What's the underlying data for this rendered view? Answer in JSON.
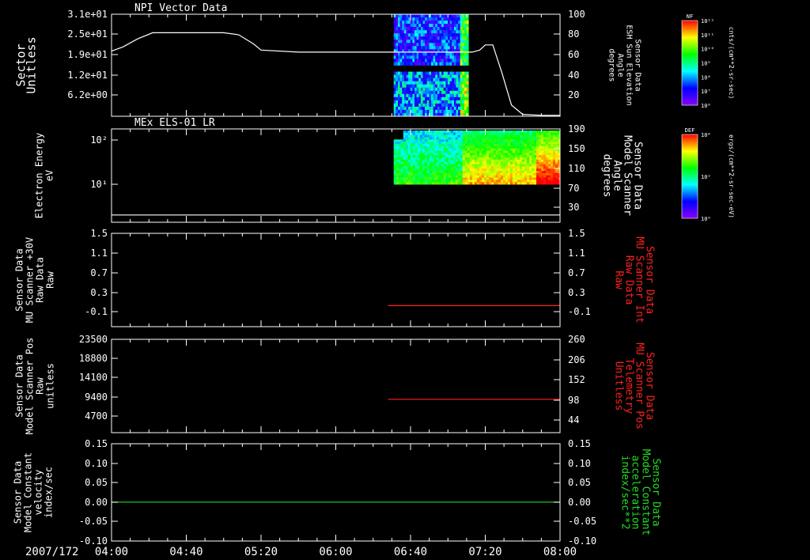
{
  "x_axis": {
    "date_label": "2007/172",
    "ticks": [
      "04:00",
      "04:40",
      "05:20",
      "06:00",
      "06:40",
      "07:20",
      "08:00"
    ],
    "range": [
      "04:00",
      "08:00"
    ]
  },
  "colors": {
    "background": "#000000",
    "axis": "#ffffff",
    "red_series": "#ff2020",
    "green_series": "#22dd22"
  },
  "chart_data": [
    {
      "type": "heatmap",
      "title": "NPI Vector Data",
      "ylabel_lines": [
        "Sector",
        "Unitless"
      ],
      "yticks": [
        "3.1e+01",
        "2.5e+01",
        "1.9e+01",
        "1.2e+01",
        "6.2e+00"
      ],
      "ylim": [
        0,
        31
      ],
      "y2label_lines": [
        "Sensor Data",
        "ESH Sun Elevation",
        "Angle",
        "degrees"
      ],
      "y2ticks": [
        "100",
        "80",
        "60",
        "40",
        "20"
      ],
      "y2lim": [
        0,
        100
      ],
      "colorbar": {
        "label": "NF",
        "unit_label": "cnts/(cm**2-sr-sec)",
        "ticks": [
          "10¹²",
          "10¹¹",
          "10¹⁰",
          "10⁹",
          "10⁸",
          "10⁷",
          "10⁶"
        ],
        "cmap": [
          "#ff0000",
          "#ffff00",
          "#00ff00",
          "#00ffff",
          "#0000ff",
          "#8800ff"
        ]
      },
      "heatmap_extent": {
        "x": [
          "06:31",
          "07:11"
        ],
        "y": [
          0,
          31
        ]
      },
      "line": {
        "name": "ESH Sun Elevation",
        "x": [
          "04:00",
          "04:06",
          "04:14",
          "04:22",
          "04:30",
          "04:40",
          "05:00",
          "05:08",
          "05:16",
          "05:20",
          "05:40",
          "06:00",
          "06:40",
          "07:04",
          "07:13",
          "07:17",
          "07:20",
          "07:24",
          "07:29",
          "07:34",
          "07:40",
          "07:50",
          "08:00"
        ],
        "y": [
          67,
          71,
          79,
          85,
          85,
          85,
          85,
          83,
          74,
          68,
          66,
          66,
          66,
          66,
          66,
          68,
          73,
          73,
          45,
          14,
          5,
          4,
          4
        ]
      }
    },
    {
      "type": "heatmap",
      "title": "MEx ELS-01 LR",
      "ylabel_lines": [
        "Electron Energy",
        "eV"
      ],
      "yticks": [
        "10²",
        "10¹"
      ],
      "ylog": true,
      "ylim": [
        0.5,
        250
      ],
      "y2label_lines": [
        "Sensor Data",
        "Model Scanner",
        "Angle",
        "degrees"
      ],
      "y2ticks": [
        "190",
        "150",
        "110",
        "70",
        "30"
      ],
      "y2lim": [
        0,
        190
      ],
      "colorbar": {
        "label": "DEF",
        "unit_label": "ergs/(cm**2-sr-sec-eV)",
        "ticks": [
          "10⁴",
          "10²",
          "10⁰"
        ],
        "cmap": [
          "#ff0000",
          "#ffff00",
          "#00ff00",
          "#00ffff",
          "#0000ff",
          "#8800ff"
        ]
      },
      "heatmap_extent": {
        "x": [
          "06:31",
          "08:00"
        ],
        "y": [
          10,
          160
        ]
      },
      "line": {
        "name": "Model Scanner Angle",
        "x": [
          "04:00",
          "08:00"
        ],
        "y": [
          10,
          10
        ]
      }
    },
    {
      "type": "line",
      "ylabel_lines": [
        "Sensor Data",
        "MU Scanner +30V",
        "Raw Data",
        "Raw"
      ],
      "yticks": [
        "1.5",
        "1.1",
        "0.7",
        "0.3",
        "-0.1"
      ],
      "ylim": [
        -0.5,
        1.5
      ],
      "y2label_lines": [
        "Sensor Data",
        "MU Scanner Int",
        "Raw Data",
        "Raw"
      ],
      "y2ticks": [
        "1.5",
        "1.1",
        "0.7",
        "0.3",
        "-0.1"
      ],
      "y2lim": [
        -0.5,
        1.5
      ],
      "series": [
        {
          "color": "#ff2020",
          "x": [
            "06:28",
            "08:00"
          ],
          "y": [
            -0.05,
            -0.05
          ]
        }
      ]
    },
    {
      "type": "line",
      "ylabel_lines": [
        "Sensor Data",
        "Model Scanner Pos",
        "Raw",
        "unitless"
      ],
      "yticks": [
        "23500",
        "18800",
        "14100",
        "9400",
        "4700"
      ],
      "ylim": [
        0,
        23500
      ],
      "y2label_lines": [
        "Sensor Data",
        "MU Scanner Pos",
        "Telemetry",
        "Unitless"
      ],
      "y2ticks": [
        "260",
        "206",
        "152",
        "98",
        "44"
      ],
      "y2lim": [
        -10,
        260
      ],
      "series": [
        {
          "color": "#ff2020",
          "x": [
            "06:28",
            "08:00"
          ],
          "y": [
            8400,
            8400
          ]
        }
      ]
    },
    {
      "type": "line",
      "ylabel_lines": [
        "Sensor Data",
        "Model Constant",
        "velocity",
        "index/sec"
      ],
      "yticks": [
        "0.15",
        "0.10",
        "0.05",
        "0.00",
        "-0.05",
        "-0.10"
      ],
      "ylim": [
        -0.1,
        0.15
      ],
      "y2label_lines": [
        "Sensor Data",
        "Model Constant",
        "acceleration",
        "index/sec**2"
      ],
      "y2ticks": [
        "0.15",
        "0.10",
        "0.05",
        "0.00",
        "-0.05",
        "-0.10"
      ],
      "y2lim": [
        -0.1,
        0.15
      ],
      "series": [
        {
          "color": "#22dd22",
          "x": [
            "04:00",
            "08:00"
          ],
          "y": [
            0,
            0
          ]
        }
      ]
    }
  ]
}
